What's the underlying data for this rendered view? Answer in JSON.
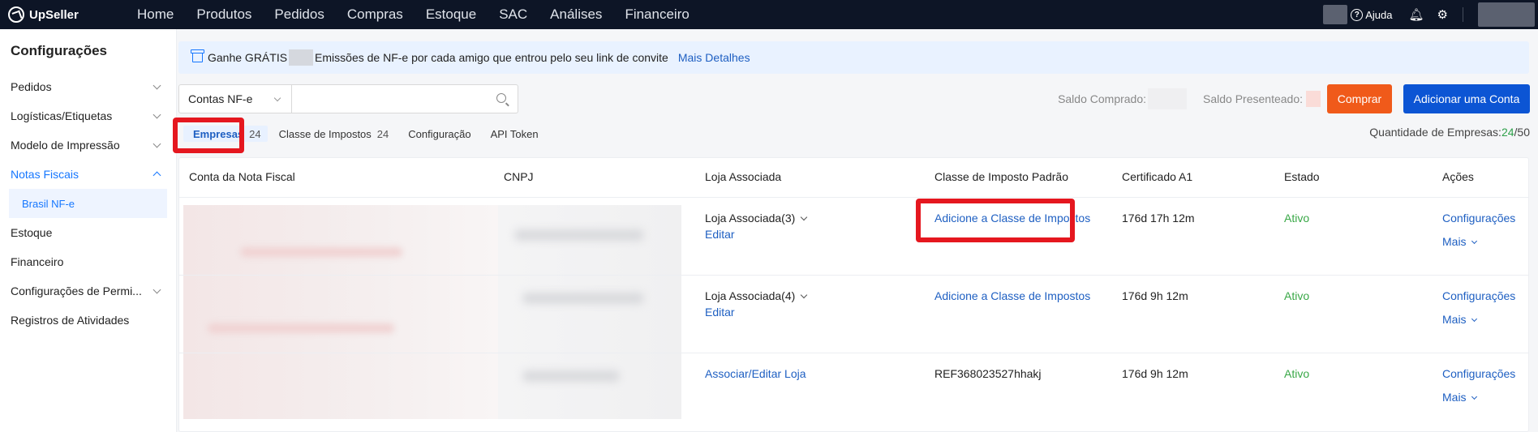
{
  "app": {
    "brand": "UpSeller"
  },
  "nav": [
    "Home",
    "Produtos",
    "Pedidos",
    "Compras",
    "Estoque",
    "SAC",
    "Análises",
    "Financeiro"
  ],
  "topright": {
    "help": "Ajuda"
  },
  "sidebar": {
    "title": "Configurações",
    "items": [
      "Pedidos",
      "Logísticas/Etiquetas",
      "Modelo de Impressão",
      "Notas Fiscais",
      "Estoque",
      "Financeiro",
      "Configurações de Permi...",
      "Registros de Atividades"
    ],
    "subitem": "Brasil NF-e"
  },
  "banner": {
    "text_before": "Ganhe GRÁTIS",
    "text_after": "Emissões de NF-e por cada amigo que entrou pelo seu link de convite",
    "link": "Mais Detalhes"
  },
  "toolbar": {
    "select_value": "Contas NF-e",
    "search_placeholder": "",
    "saldo_comprado": "Saldo Comprado:",
    "saldo_presenteado": "Saldo Presenteado:",
    "comprar": "Comprar",
    "adicionar": "Adicionar uma Conta"
  },
  "tabs": [
    {
      "label": "Empresas",
      "count": "24"
    },
    {
      "label": "Classe de Impostos",
      "count": "24"
    },
    {
      "label": "Configuração",
      "count": ""
    },
    {
      "label": "API Token",
      "count": ""
    }
  ],
  "quantidade": {
    "label": "Quantidade de Empresas:",
    "used": "24",
    "total": "/50"
  },
  "table": {
    "headers": [
      "Conta da Nota Fiscal",
      "CNPJ",
      "Loja Associada",
      "Classe de Imposto Padrão",
      "Certificado A1",
      "Estado",
      "Ações"
    ],
    "rows": [
      {
        "loja": "Loja Associada(3)",
        "editar": "Editar",
        "classe": "Adicione a Classe de Impostos",
        "cert": "176d 17h 12m",
        "estado": "Ativo",
        "config": "Configurações",
        "mais": "Mais"
      },
      {
        "loja": "Loja Associada(4)",
        "editar": "Editar",
        "classe": "Adicione a Classe de Impostos",
        "cert": "176d 9h 12m",
        "estado": "Ativo",
        "config": "Configurações",
        "mais": "Mais"
      },
      {
        "loja": "Associar/Editar Loja",
        "editar": "",
        "classe": "REF368023527hhakj",
        "cert": "176d 9h 12m",
        "estado": "Ativo",
        "config": "Configurações",
        "mais": "Mais"
      }
    ]
  },
  "colors": {
    "topbar": "#0d1526",
    "accent": "#1677ff",
    "orange": "#f05a1a",
    "blue_button": "#0c55d4",
    "highlight": "#e5171f",
    "active_green": "#39a847"
  }
}
